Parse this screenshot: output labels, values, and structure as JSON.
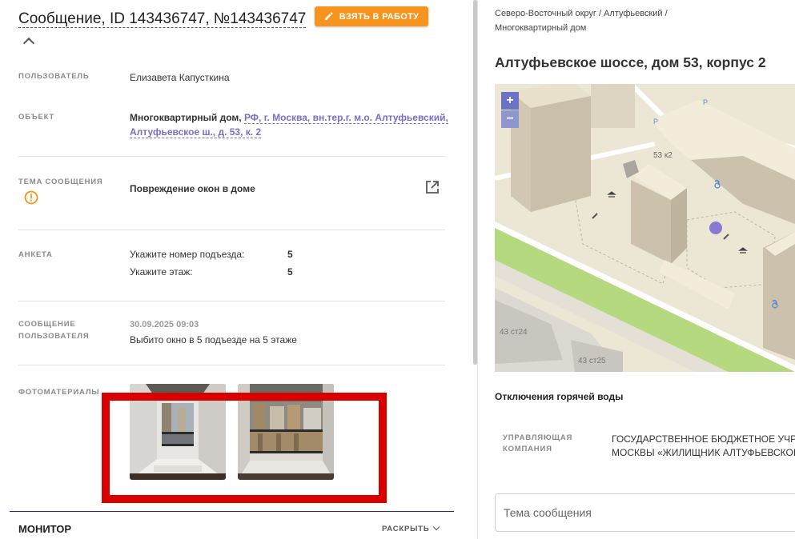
{
  "header": {
    "title": "Сообщение, ID 143436747, №143436747",
    "take_button": "ВЗЯТЬ В РАБОТУ"
  },
  "fields": {
    "user": {
      "label": "ПОЛЬЗОВАТЕЛЬ",
      "value": "Елизавета Капусткина"
    },
    "object": {
      "label": "ОБЪЕКТ",
      "type": "Многоквартирный дом,",
      "link": "РФ, г. Москва, вн.тер.г. м.о. Алтуфьевский, Алтуфьевское ш., д. 53, к. 2"
    },
    "topic": {
      "label": "ТЕМА СООБЩЕНИЯ",
      "value": "Повреждение окон в доме"
    },
    "survey": {
      "label": "АНКЕТА",
      "rows": [
        {
          "q": "Укажите номер подъезда:",
          "a": "5"
        },
        {
          "q": "Укажите этаж:",
          "a": "5"
        }
      ]
    },
    "message": {
      "label_line1": "СООБЩЕНИЕ",
      "label_line2": "ПОЛЬЗОВАТЕЛЯ",
      "date": "30.09.2025 09:03",
      "text": "Выбито окно в 5 подъезде на 5 этаже"
    },
    "photos": {
      "label": "ФОТОМАТЕРИАЛЫ"
    }
  },
  "monitor": {
    "title": "МОНИТОР",
    "expand": "РАСКРЫТЬ"
  },
  "side": {
    "breadcrumb": "Северо-Восточный округ / Алтуфьевский / Многоквартирный дом",
    "address": "Алтуфьевское шоссе, дом 53, корпус 2",
    "map": {
      "zoom_in": "+",
      "zoom_out": "−",
      "labels": {
        "building_main": "53 к2",
        "building_a": "43 ст24",
        "building_b": "43 ст25",
        "parking": "P"
      }
    },
    "hot_water": "Отключения горячей воды",
    "management": {
      "label_line1": "УПРАВЛЯЮЩАЯ",
      "label_line2": "КОМПАНИЯ",
      "value_line1": "ГОСУДАРСТВЕННОЕ БЮДЖЕТНОЕ УЧРЕ",
      "value_line2": "МОСКВЫ «ЖИЛИЩНИК АЛТУФЬЕВСКОГ"
    },
    "topic_placeholder": "Тема сообщения"
  },
  "colors": {
    "accent": "#f7941e",
    "link": "#7b6cc7",
    "highlight": "#d90000",
    "zoom": "#6a74c6"
  }
}
